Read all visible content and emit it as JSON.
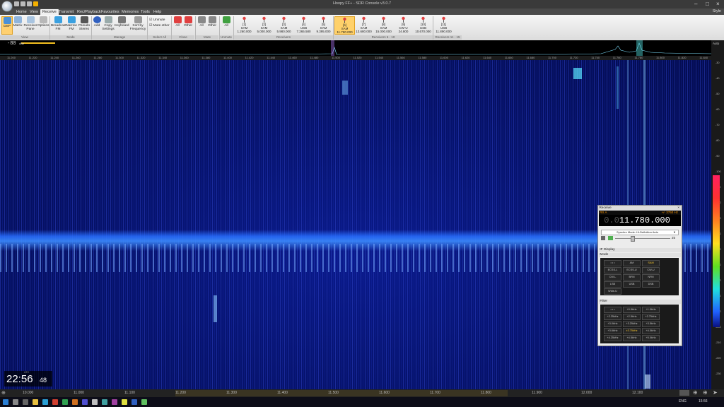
{
  "titlebar": {
    "title": "Hoopy FF+ - SDR Console v3.0.7"
  },
  "tabs": [
    {
      "label": "Home"
    },
    {
      "label": "View"
    },
    {
      "label": "Receive"
    },
    {
      "label": "Transmit"
    },
    {
      "label": "Rec/Playback"
    },
    {
      "label": "Favourites"
    },
    {
      "label": "Memories"
    },
    {
      "label": "Tools"
    },
    {
      "label": "Help"
    }
  ],
  "style_label": "Style",
  "ribbon": {
    "view": {
      "dsp": "DSP",
      "matrix": "Matrix",
      "receiver_pane": "Receiver Pane",
      "options": "Options",
      "group": "View"
    },
    "mode": {
      "broadcast": "Broadcast FM",
      "narrow": "Narrow FM",
      "pseudo": "Pseudo Stereo",
      "group": "Mode"
    },
    "manage": {
      "add": "Add",
      "copy": "Copy Settings",
      "keyboard": "Keyboard",
      "sort": "Sort by Frequency",
      "group": "Manage"
    },
    "select": {
      "unmute": "Unmute",
      "mute_other": "Mute other",
      "group": "Select All"
    },
    "close": {
      "all": "All",
      "other": "Other",
      "group": "Close"
    },
    "mute": {
      "all": "All",
      "other": "Other",
      "group": "Mute"
    },
    "unmute": {
      "all": "All",
      "group": "Unmute"
    },
    "receivers_a": [
      {
        "n": "[1]",
        "mode": "SAM",
        "freq": "1.260.000"
      },
      {
        "n": "[2]",
        "mode": "SAM",
        "freq": "5.000.000"
      },
      {
        "n": "[3]",
        "mode": "SAM",
        "freq": "5.980.000"
      },
      {
        "n": "[4]",
        "mode": "USB",
        "freq": "7.265.580"
      },
      {
        "n": "[5]",
        "mode": "SAM",
        "freq": "9.395.000"
      }
    ],
    "receivers_a_group": "Receivers",
    "receivers_b": [
      {
        "n": "[6]",
        "mode": "SAM",
        "freq": "11.780.000"
      },
      {
        "n": "[7]",
        "mode": "SAM",
        "freq": "13.680.000"
      },
      {
        "n": "[8]",
        "mode": "SAM",
        "freq": "15.000.000"
      },
      {
        "n": "[9]",
        "mode": "CW-U",
        "freq": "24.800"
      },
      {
        "n": "[10]",
        "mode": "USB",
        "freq": "10.670.000"
      }
    ],
    "receivers_b_group": "Receivers 6 - 10",
    "receivers_c": [
      {
        "n": "[11]",
        "mode": "USB",
        "freq": "11.890.000"
      }
    ],
    "receivers_c_group": "Receivers 11 - 15"
  },
  "spectrum": {
    "dbm": "-80",
    "dbm_unit": "dBm",
    "top_ticks": [
      "11.200",
      "11.220",
      "11.240",
      "11.260",
      "11.280",
      "11.300",
      "11.320",
      "11.340",
      "11.360",
      "11.380",
      "11.400",
      "11.420",
      "11.440",
      "11.460",
      "11.480",
      "11.500",
      "11.520",
      "11.540",
      "11.560",
      "11.580",
      "11.600",
      "11.620",
      "11.640",
      "11.660",
      "11.680",
      "11.700",
      "11.720",
      "11.740",
      "11.760",
      "11.780",
      "11.800",
      "11.820",
      "11.840"
    ],
    "auto": "Auto",
    "db_ticks": [
      "-30",
      "-40",
      "-50",
      "-60",
      "-70",
      "-80",
      "-90",
      "-100",
      "-110",
      "-120",
      "-130",
      "-140",
      "-150",
      "-160",
      "-170",
      "-180",
      "-190",
      "-200",
      "-210",
      "-220",
      "-230"
    ]
  },
  "bottom_axis": [
    "10.000",
    "11.000",
    "11.100",
    "11.200",
    "11.300",
    "11.400",
    "11.500",
    "11.600",
    "11.700",
    "11.800",
    "11.900",
    "12.000",
    "12.100"
  ],
  "clock": {
    "utc": "UTC",
    "hm": "22:56",
    "ss": "48"
  },
  "receive_panel": {
    "title": "Receive",
    "header_left": "RX A",
    "header_right": "+/- 3750 Hz",
    "freq_dim": "0.0",
    "freq_main": "11.780.000",
    "selector": "Synchro Mode: Hi-Definition Auto",
    "volume": "25",
    "if_display": "IF Display",
    "mode_label": "Mode",
    "modes": [
      "• • •",
      "AM",
      "SAM",
      "ECSS-L",
      "ECSS-U",
      "CW-U",
      "CW-L",
      "BFM",
      "NFM",
      "LSB",
      "USB",
      "DSB",
      "Wide-U"
    ],
    "filter_label": "Filter",
    "filters": [
      "• • •",
      "+0.5kHz",
      "+1.0kHz",
      "+2.25kHz",
      "+2.5kHz",
      "+2.75kHz",
      "+3.0kHz",
      "+3.25kHz",
      "+3.5kHz",
      "+3.6kHz",
      "±3.75kHz",
      "+4.0kHz",
      "+4.25kHz",
      "+4.5kHz",
      "+5.0kHz"
    ]
  },
  "taskbar": {
    "lang": "ENG",
    "time": "15:56"
  }
}
